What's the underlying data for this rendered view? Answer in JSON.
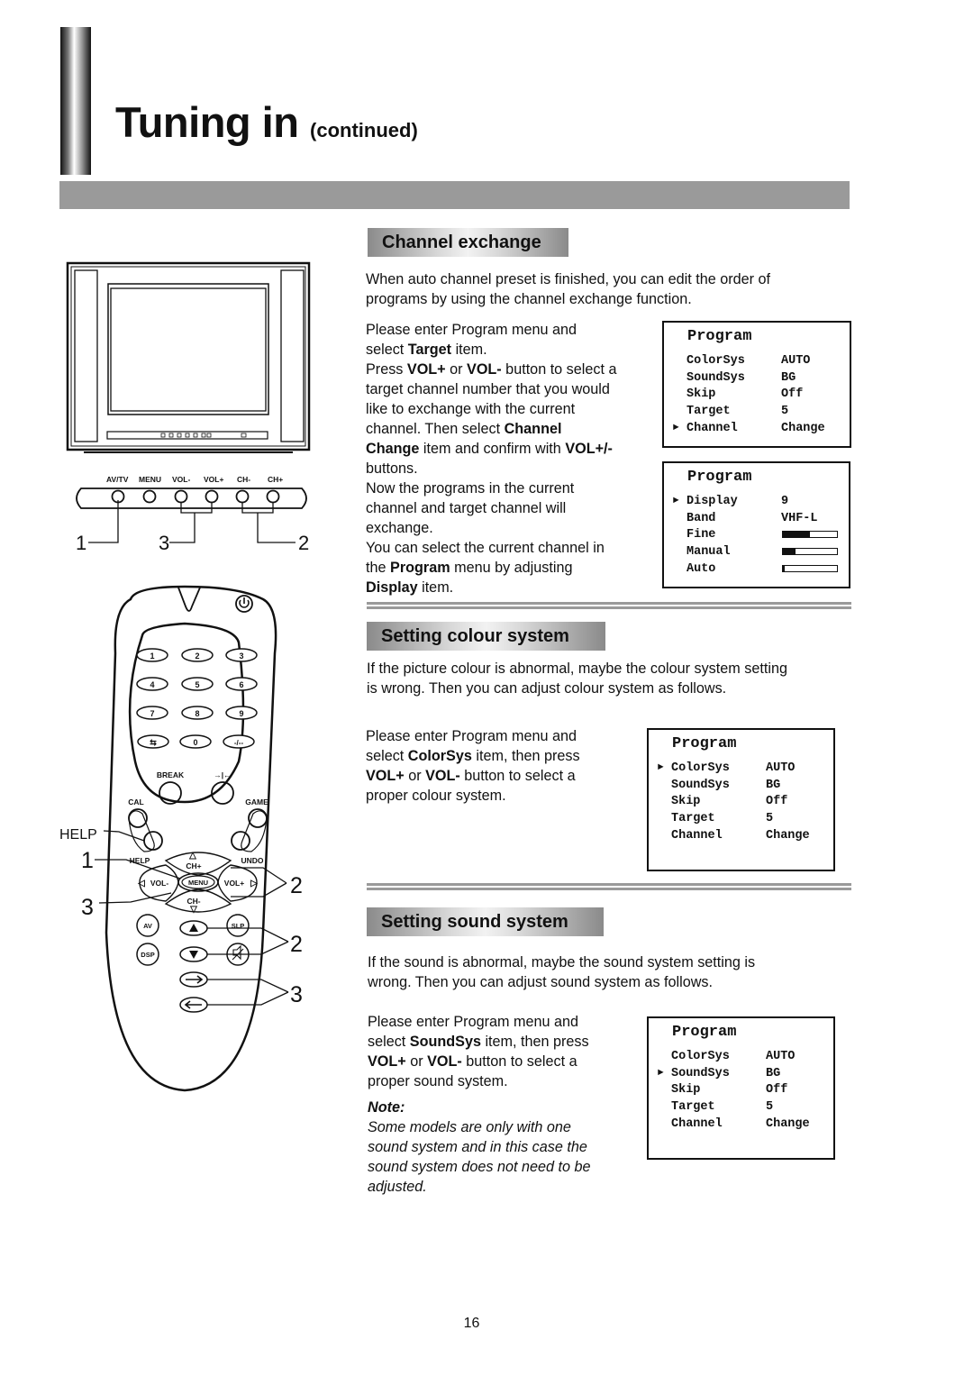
{
  "header": {
    "title": "Tuning in",
    "subtitle": "(continued)"
  },
  "sections": {
    "channel_exchange": {
      "heading": "Channel exchange",
      "intro": [
        "When auto channel preset is finished, you can edit the order of",
        "programs by using the channel exchange function."
      ],
      "steps": [
        [
          {
            "t": "Please enter Program menu and"
          }
        ],
        [
          {
            "t": "select "
          },
          {
            "t": "Target",
            "b": true
          },
          {
            "t": " item."
          }
        ],
        [
          {
            "t": "Press "
          },
          {
            "t": "VOL+",
            "b": true
          },
          {
            "t": " or "
          },
          {
            "t": "VOL-",
            "b": true
          },
          {
            "t": " button to select a"
          }
        ],
        [
          {
            "t": "target channel number that you would"
          }
        ],
        [
          {
            "t": "like to exchange with the current"
          }
        ],
        [
          {
            "t": "channel. Then select "
          },
          {
            "t": "Channel",
            "b": true
          }
        ],
        [
          {
            "t": "Change",
            "b": true
          },
          {
            "t": " item and confirm with "
          },
          {
            "t": "VOL+/-",
            "b": true
          }
        ],
        [
          {
            "t": "buttons."
          }
        ],
        [
          {
            "t": "Now the programs in the current"
          }
        ],
        [
          {
            "t": "channel and target channel will"
          }
        ],
        [
          {
            "t": "exchange."
          }
        ],
        [
          {
            "t": "You can select the current channel in"
          }
        ],
        [
          {
            "t": "the "
          },
          {
            "t": "Program",
            "b": true
          },
          {
            "t": " menu by adjusting"
          }
        ],
        [
          {
            "t": "Display",
            "b": true
          },
          {
            "t": " item."
          }
        ]
      ]
    },
    "colour_system": {
      "heading": "Setting colour system",
      "intro": [
        "If the picture colour is abnormal, maybe the colour system setting",
        "is wrong. Then you can adjust colour system as follows."
      ],
      "steps": [
        [
          {
            "t": "Please enter Program menu and"
          }
        ],
        [
          {
            "t": "select "
          },
          {
            "t": "ColorSys",
            "b": true
          },
          {
            "t": " item, then press"
          }
        ],
        [
          {
            "t": "VOL+",
            "b": true
          },
          {
            "t": " or "
          },
          {
            "t": "VOL-",
            "b": true
          },
          {
            "t": " button to select a"
          }
        ],
        [
          {
            "t": "proper colour system."
          }
        ]
      ]
    },
    "sound_system": {
      "heading": "Setting sound system",
      "intro": [
        "If the sound is abnormal, maybe the sound system setting is",
        "wrong. Then you can adjust sound system as follows."
      ],
      "steps": [
        [
          {
            "t": "Please enter Program menu and"
          }
        ],
        [
          {
            "t": "select "
          },
          {
            "t": "SoundSys",
            "b": true
          },
          {
            "t": " item, then press"
          }
        ],
        [
          {
            "t": "VOL+",
            "b": true
          },
          {
            "t": " or "
          },
          {
            "t": "VOL-",
            "b": true
          },
          {
            "t": " button to select a"
          }
        ],
        [
          {
            "t": "proper sound system."
          }
        ]
      ],
      "note_label": "Note:",
      "note_lines": [
        "Some models are only with one",
        "sound system and in this case the",
        "sound system does not need to be",
        "adjusted."
      ]
    }
  },
  "osd_menus": {
    "menu_channel": {
      "title": "Program",
      "selected": 4,
      "rows": [
        {
          "label": "ColorSys",
          "value": "AUTO"
        },
        {
          "label": "SoundSys",
          "value": "BG"
        },
        {
          "label": "Skip",
          "value": "Off"
        },
        {
          "label": "Target",
          "value": "5"
        },
        {
          "label": "Channel",
          "value": "Change"
        }
      ]
    },
    "menu_display": {
      "title": "Program",
      "selected": 0,
      "rows": [
        {
          "label": "Display",
          "value": "9"
        },
        {
          "label": "Band",
          "value": "VHF-L"
        },
        {
          "label": "Fine",
          "level_percent": 50
        },
        {
          "label": "Manual",
          "level_percent": 23
        },
        {
          "label": "Auto",
          "level_percent": 3
        }
      ]
    },
    "menu_colorsys": {
      "title": "Program",
      "selected": 0,
      "rows": [
        {
          "label": "ColorSys",
          "value": "AUTO"
        },
        {
          "label": "SoundSys",
          "value": "BG"
        },
        {
          "label": "Skip",
          "value": "Off"
        },
        {
          "label": "Target",
          "value": "5"
        },
        {
          "label": "Channel",
          "value": "Change"
        }
      ]
    },
    "menu_soundsys": {
      "title": "Program",
      "selected": 1,
      "rows": [
        {
          "label": "ColorSys",
          "value": "AUTO"
        },
        {
          "label": "SoundSys",
          "value": "BG"
        },
        {
          "label": "Skip",
          "value": "Off"
        },
        {
          "label": "Target",
          "value": "5"
        },
        {
          "label": "Channel",
          "value": "Change"
        }
      ]
    },
    "pointer_glyph": "►"
  },
  "tv_panel": {
    "buttons": [
      "AV/TV",
      "MENU",
      "VOL-",
      "VOL+",
      "CH-",
      "CH+"
    ],
    "callouts": [
      "1",
      "3",
      "2"
    ]
  },
  "remote": {
    "digits": [
      "1",
      "2",
      "3",
      "4",
      "5",
      "6",
      "7",
      "8",
      "9",
      "0",
      "-/--"
    ],
    "labels": {
      "break": "BREAK",
      "cal": "CAL",
      "game": "GAME",
      "help": "HELP",
      "help_callout": "HELP",
      "undo": "UNDO",
      "ch_plus": "CH+",
      "ch_minus": "CH-",
      "vol_minus": "VOL-",
      "vol_plus": "VOL+",
      "menu": "MENU",
      "av": "AV",
      "dsp": "DSP",
      "slp": "SLP"
    },
    "callouts": {
      "left_1": "1",
      "left_3": "3",
      "right_2a": "2",
      "right_2b": "2",
      "right_3": "3"
    }
  },
  "footer": {
    "page_number": "16"
  }
}
